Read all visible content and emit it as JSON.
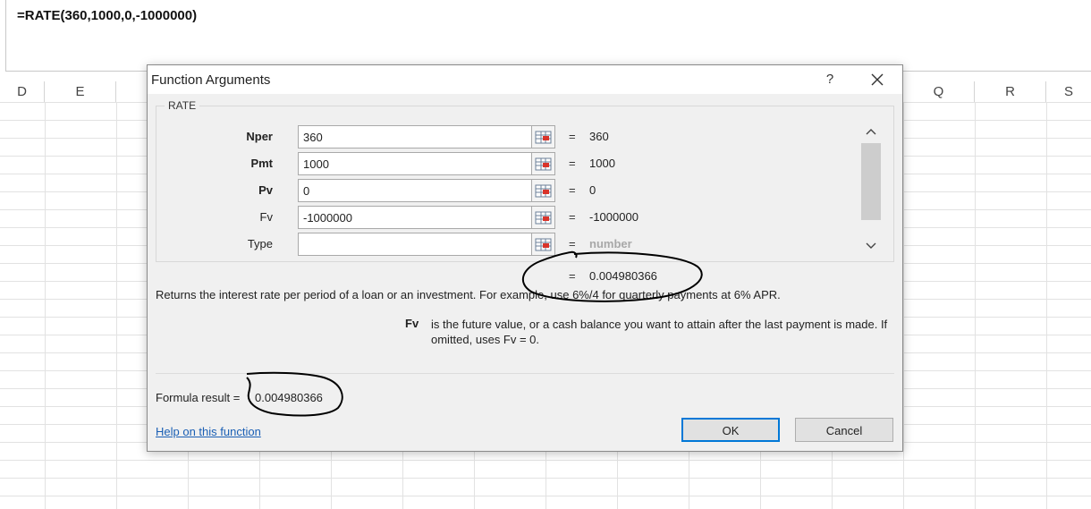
{
  "formula_bar": {
    "formula": "=RATE(360,1000,0,-1000000)"
  },
  "columns": [
    {
      "label": "D"
    },
    {
      "label": "E"
    },
    {
      "label": "Q"
    },
    {
      "label": "R"
    },
    {
      "label": "S"
    }
  ],
  "dialog": {
    "title": "Function Arguments",
    "help_label": "?",
    "group_label": "RATE",
    "arguments": [
      {
        "name": "Nper",
        "value": "360",
        "result": "360"
      },
      {
        "name": "Pmt",
        "value": "1000",
        "result": "1000"
      },
      {
        "name": "Pv",
        "value": "0",
        "result": "0"
      },
      {
        "name": "Fv",
        "value": "-1000000",
        "result": "-1000000"
      },
      {
        "name": "Type",
        "value": "",
        "result": "number"
      }
    ],
    "equals": "=",
    "function_result": "0.004980366",
    "description": "Returns the interest rate per period of a loan or an investment. For example, use 6%/4 for quarterly payments at 6% APR.",
    "arg_help_name": "Fv",
    "arg_help_text": "is the future value, or a cash balance you want to attain after the last payment is made. If omitted, uses Fv = 0.",
    "formula_result_label": "Formula result =",
    "formula_result_value": "0.004980366",
    "help_link": "Help on this function",
    "ok_label": "OK",
    "cancel_label": "Cancel"
  }
}
